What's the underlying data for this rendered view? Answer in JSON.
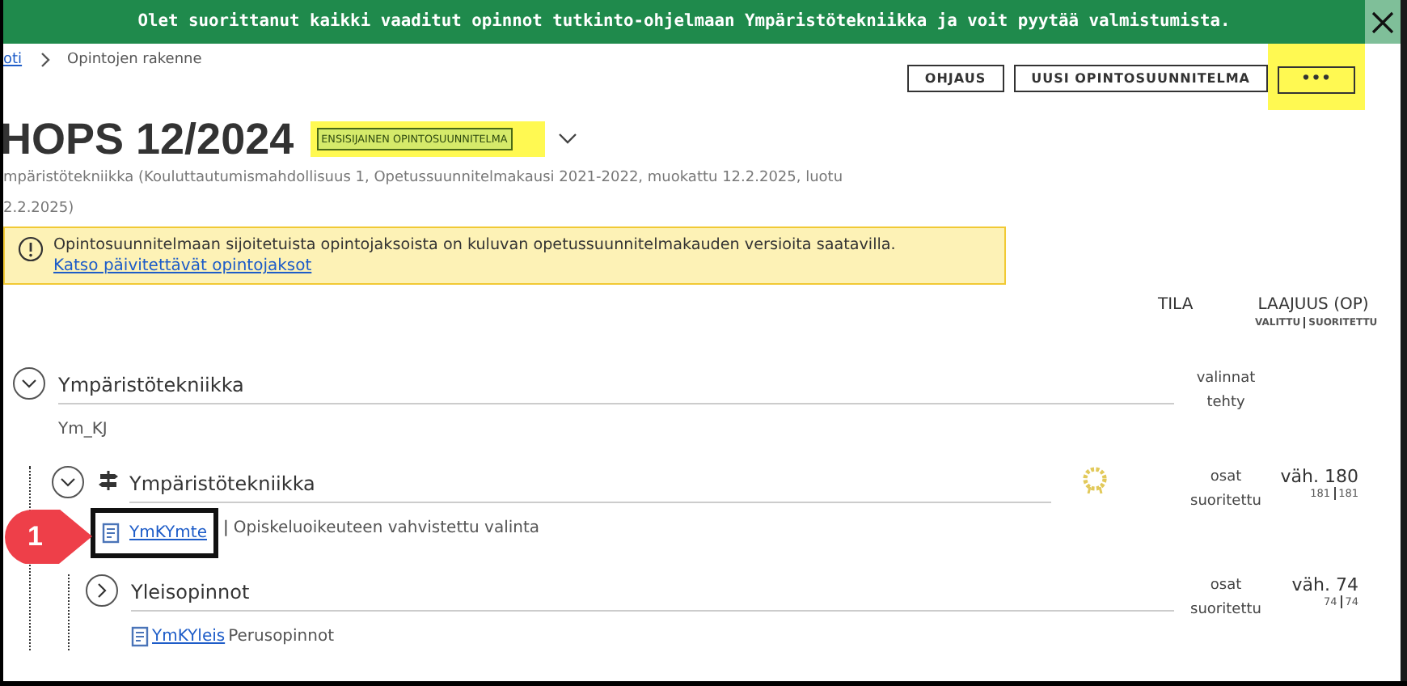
{
  "banner": {
    "text": "Olet suorittanut kaikki vaaditut opinnot tutkinto-ohjelmaan Ympäristötekniikka ja voit pyytää valmistumista."
  },
  "breadcrumb": [
    {
      "label": "oti",
      "link": true
    },
    {
      "label": "Opintojen rakenne",
      "link": false
    }
  ],
  "actions": [
    {
      "label": "OHJAUS",
      "kind": "text",
      "highlighted": false
    },
    {
      "label": "UUSI OPINTOSUUNNITELMA",
      "kind": "text",
      "highlighted": false
    },
    {
      "label": "•••",
      "kind": "more",
      "highlighted": true
    }
  ],
  "title": "HOPS 12/2024",
  "badge": {
    "label": "ENSISIJAINEN OPINTOSUUNNITELMA",
    "highlighted": true
  },
  "subtitle": [
    "mpäristötekniikka (Kouluttautumismahdollisuus 1, Opetussuunnitelmakausi 2021-2022, muokattu 12.2.2025, luotu",
    "2.2.2025)"
  ],
  "notice": {
    "text": "Opintosuunnitelmaan sijoitetuista opintojaksoista on kuluvan opetussuunnitelmakauden versioita saatavilla.",
    "link": "Katso päivitettävät opintojaksot"
  },
  "columns": {
    "status": "TILA",
    "credits": "LAAJUUS (OP)",
    "selected": "VALITTU",
    "completed": "SUORITETTU"
  },
  "tree": [
    {
      "title": "Ympäristötekniikka",
      "expanded": true,
      "code": "Ym_KJ",
      "code_link": false,
      "status": "valinnat tehty",
      "children": [
        {
          "title": "Ympäristötekniikka",
          "expanded": true,
          "signpost": true,
          "award": true,
          "code": "YmKYmte",
          "code_link": true,
          "separator": "|",
          "description": "Opiskeluoikeuteen vahvistettu valinta",
          "annotation": "1",
          "status": "osat suoritettu",
          "credits": "väh. 180",
          "selected": "181",
          "completed": "181",
          "children": [
            {
              "title": "Yleisopinnot",
              "expanded": false,
              "code": "YmKYleis",
              "code_link": true,
              "description": "Perusopinnot",
              "status": "osat suoritettu",
              "credits": "väh. 74",
              "selected": "74",
              "completed": "74"
            }
          ]
        }
      ]
    }
  ]
}
